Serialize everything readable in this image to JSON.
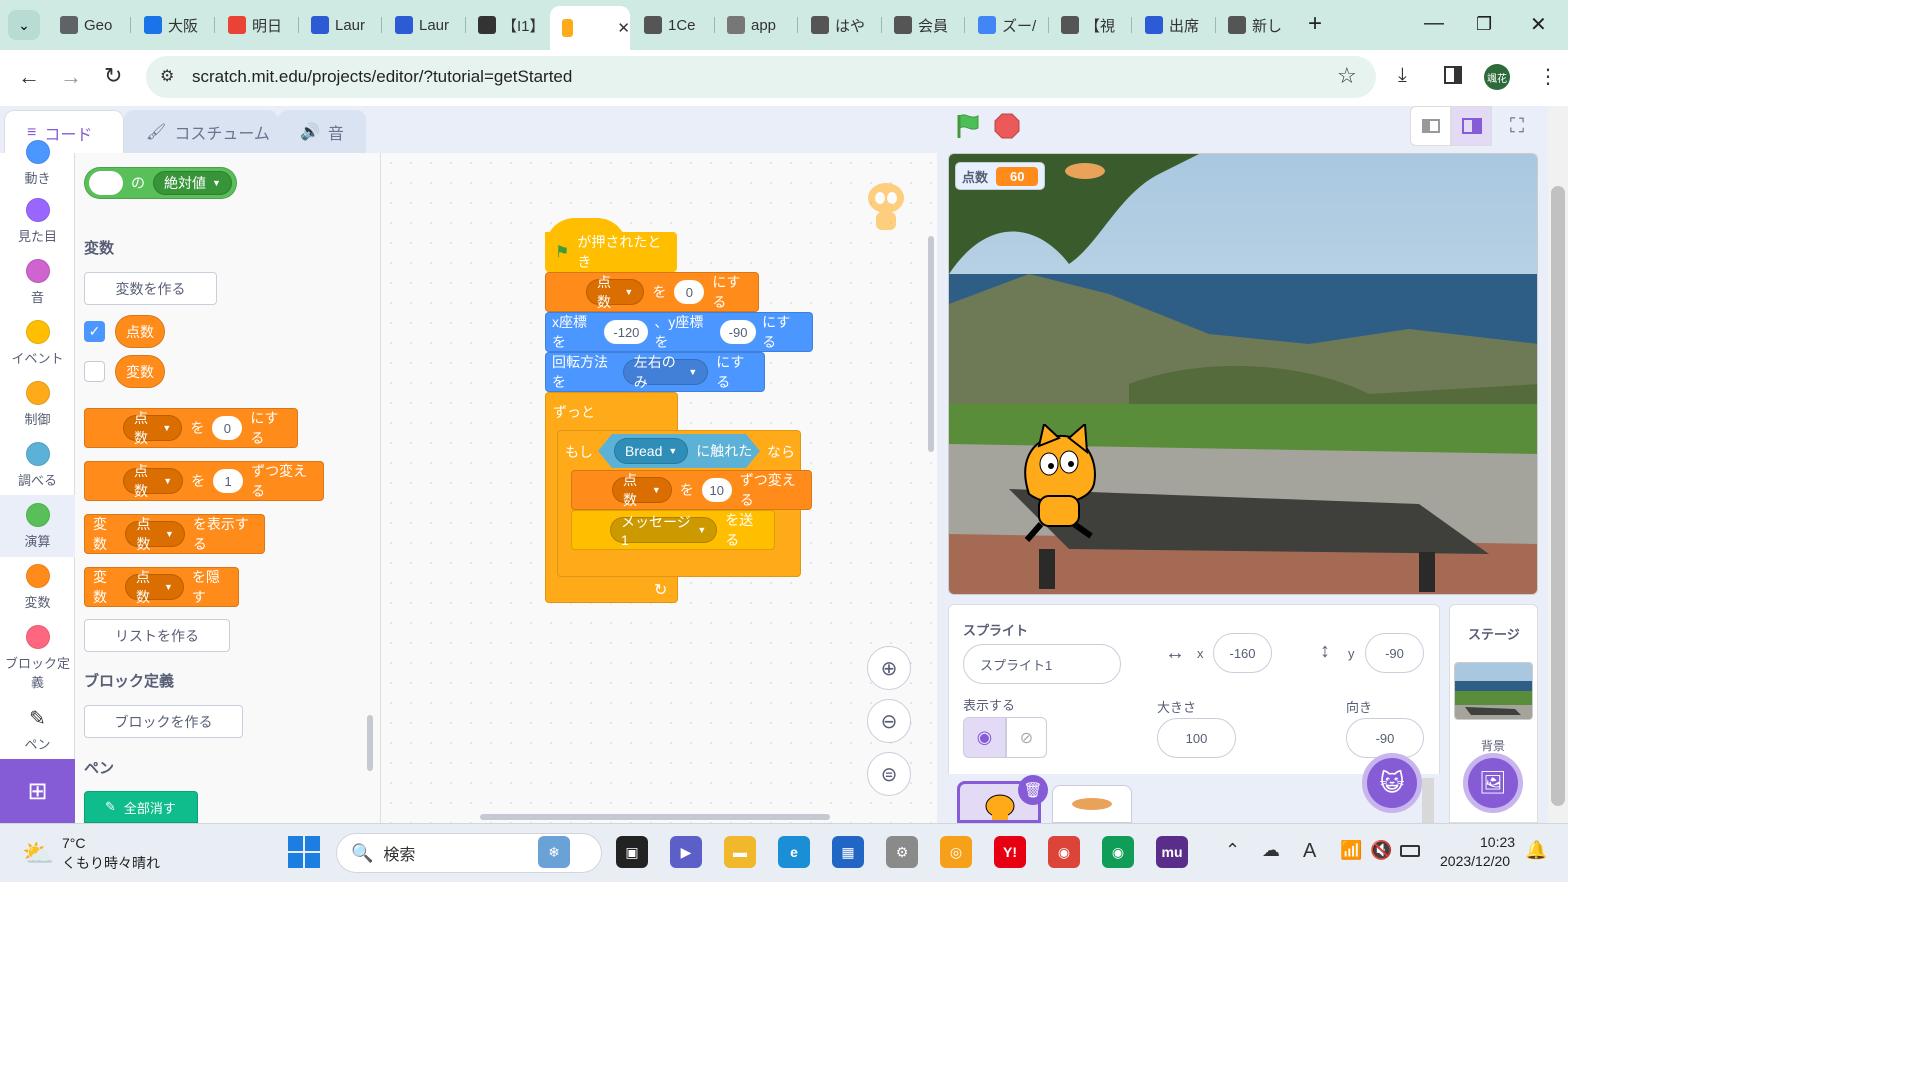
{
  "browser": {
    "tabs": [
      {
        "label": "Geo",
        "icon": "gear-icon",
        "color": "#5f6368"
      },
      {
        "label": "大阪",
        "icon": "calendar-icon",
        "color": "#1a73e8"
      },
      {
        "label": "明日",
        "icon": "gmail-icon",
        "color": "#ea4335"
      },
      {
        "label": "Laur",
        "icon": "zoom-icon",
        "color": "#2d5bd6"
      },
      {
        "label": "Laur",
        "icon": "zoom-icon",
        "color": "#2d5bd6"
      },
      {
        "label": "【I1】",
        "icon": "classroom-icon",
        "color": "#333"
      },
      {
        "label": "",
        "icon": "scratch-icon",
        "color": "#ffab19"
      },
      {
        "label": "1Ce",
        "icon": "globe-icon",
        "color": "#555"
      },
      {
        "label": "app",
        "icon": "globe-icon",
        "color": "#777"
      },
      {
        "label": "はや",
        "icon": "doc-icon",
        "color": "#555"
      },
      {
        "label": "会員",
        "icon": "doc-icon",
        "color": "#555"
      },
      {
        "label": "ズー/",
        "icon": "google-icon",
        "color": "#4285f4"
      },
      {
        "label": "【視",
        "icon": "doc-icon",
        "color": "#555"
      },
      {
        "label": "出席",
        "icon": "zoom-icon",
        "color": "#2d5bd6"
      },
      {
        "label": "新し",
        "icon": "chrome-icon",
        "color": "#555"
      }
    ],
    "url": "scratch.mit.edu/projects/editor/?tutorial=getStarted",
    "profile": "颯花"
  },
  "editor": {
    "tabs": {
      "code": "コード",
      "costume": "コスチューム",
      "sound": "音"
    },
    "categories": [
      {
        "label": "動き",
        "color": "#4c97ff"
      },
      {
        "label": "見た目",
        "color": "#9966ff"
      },
      {
        "label": "音",
        "color": "#cf63cf"
      },
      {
        "label": "イベント",
        "color": "#ffbf00"
      },
      {
        "label": "制御",
        "color": "#ffab19"
      },
      {
        "label": "調べる",
        "color": "#5cb1d6"
      },
      {
        "label": "演算",
        "color": "#59c059"
      },
      {
        "label": "変数",
        "color": "#ff8c1a"
      },
      {
        "label": "ブロック定義",
        "color": "#ff6680"
      },
      {
        "label": "ペン",
        "color": "#0fbd8c"
      }
    ],
    "palette": {
      "abs_of": "の",
      "abs_dd": "絶対値",
      "vars_header": "変数",
      "make_var": "変数を作る",
      "var1": "点数",
      "var2": "変数",
      "set_var": "点数",
      "set_to": "を",
      "set_val": "0",
      "set_suffix": "にする",
      "change_var": "点数",
      "change_by": "を",
      "change_val": "1",
      "change_suffix": "ずつ変える",
      "show_prefix": "変数",
      "show_var": "点数",
      "show_suffix": "を表示する",
      "hide_prefix": "変数",
      "hide_var": "点数",
      "hide_suffix": "を隠す",
      "make_list": "リストを作る",
      "myblocks_header": "ブロック定義",
      "make_block": "ブロックを作る",
      "pen_header": "ペン",
      "pen_clear": "全部消す"
    },
    "script": {
      "hat": "が押されたとき",
      "set_var": "点数",
      "set_wo": "を",
      "set_val": "0",
      "set_suffix": "にする",
      "goto_x_label": "x座標を",
      "goto_x": "-120",
      "goto_y_label": "、y座標を",
      "goto_y": "-90",
      "goto_suffix": "にする",
      "rot_label": "回転方法を",
      "rot_val": "左右のみ",
      "rot_suffix": "にする",
      "forever": "ずっと",
      "if": "もし",
      "touching_obj": "Bread",
      "touching": "に触れた",
      "then": "なら",
      "change_var": "点数",
      "change_wo": "を",
      "change_val": "10",
      "change_suffix": "ずつ変える",
      "broadcast": "メッセージ1",
      "broadcast_suffix": "を送る"
    }
  },
  "stage": {
    "monitor_label": "点数",
    "monitor_value": "60"
  },
  "sprite_info": {
    "header": "スプライト",
    "name": "スプライト1",
    "x_label": "x",
    "x": "-160",
    "y_label": "y",
    "y": "-90",
    "show_label": "表示する",
    "size_label": "大きさ",
    "size": "100",
    "dir_label": "向き",
    "direction": "-90",
    "stage_header": "ステージ",
    "backdrop_label": "背景"
  },
  "taskbar": {
    "temp": "7°C",
    "weather": "くもり時々晴れ",
    "search": "検索",
    "time": "10:23",
    "date": "2023/12/20"
  },
  "colors": {
    "motion": "#4c97ff",
    "events": "#ffbf00",
    "control": "#ffab19",
    "variables": "#ff8c1a",
    "operators": "#59c059",
    "scratch_purple": "#855cd6"
  }
}
